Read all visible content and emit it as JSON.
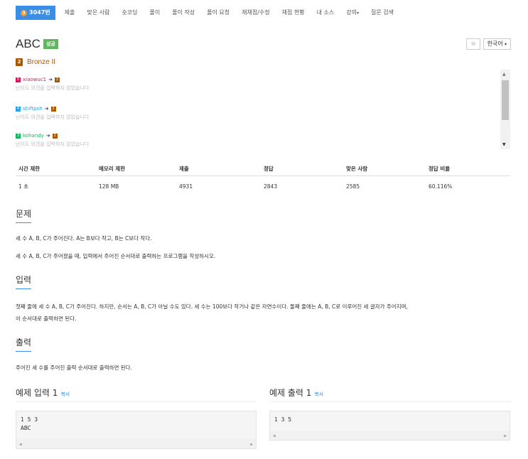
{
  "nav": {
    "active_tab": "3047번",
    "tabs": [
      "제출",
      "맞은 사람",
      "숏코딩",
      "풀이",
      "풀이 작성",
      "풀이 요청",
      "재채점/수정",
      "채점 현황",
      "내 소스",
      "강의",
      "질문 검색"
    ]
  },
  "problem": {
    "title": "ABC",
    "result_badge": "성공",
    "tier_label": "Bronze II",
    "tier_level": "2",
    "language_button": "한국어",
    "star_icon": "☆"
  },
  "opinions": [
    {
      "user": "xiaowuc1",
      "user_level": "5",
      "user_color": "#e0115f",
      "target": "2",
      "note": "난이도 의견을 입력하지 않았습니다"
    },
    {
      "user": "shiftpsh",
      "user_level": "4",
      "user_color": "#27a1e8",
      "target": "2",
      "note": "난이도 의견을 입력하지 않았습니다"
    },
    {
      "user": "kohandy",
      "user_level": "3",
      "user_color": "#18b55a",
      "target": "2",
      "note": "난이도 의견을 입력하지 않았습니다"
    }
  ],
  "stats": {
    "headers": [
      "시간 제한",
      "메모리 제한",
      "제출",
      "정답",
      "맞은 사람",
      "정답 비율"
    ],
    "values": [
      "1 초",
      "128 MB",
      "4931",
      "2843",
      "2585",
      "60.116%"
    ]
  },
  "sections": {
    "problem_heading": "문제",
    "problem_p1": "세 수 A, B, C가 주어진다. A는 B보다 작고, B는 C보다 작다.",
    "problem_p2": "세 수 A, B, C가 주어졌을 때, 입력에서 주어진 순서대로 출력하는 프로그램을 작성하시오.",
    "input_heading": "입력",
    "input_p1": "첫째 줄에 세 수 A, B, C가 주어진다. 하지만, 순서는 A, B, C가 아닐 수도 있다. 세 수는 100보다 작거나 같은 자연수이다. 둘째 줄에는 A, B, C로 이루어진 세 글자가 주어지며,",
    "input_p2": "이 순서대로 출력하면 된다.",
    "output_heading": "출력",
    "output_p1": "주어진 세 수를 주어진 출력 순서대로 출력하면 된다."
  },
  "samples": {
    "input_heading": "예제 입력 1",
    "output_heading": "예제 출력 1",
    "copy_label": "복사",
    "input_line1": "1 5 3",
    "input_line2": "ABC",
    "output_line1": "1 3 5"
  },
  "colors": {
    "accent": "#3a8ee6",
    "success": "#5cb85c",
    "bronze": "#ad5600"
  }
}
